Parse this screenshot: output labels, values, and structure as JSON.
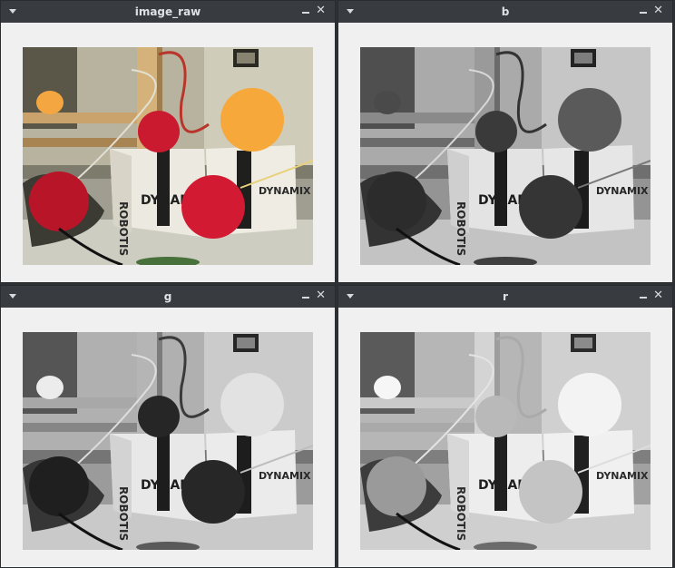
{
  "windows": [
    {
      "title": "image_raw",
      "mode": "color",
      "image_name": "camera-image-raw"
    },
    {
      "title": "b",
      "mode": "blue-channel",
      "image_name": "camera-image-blue"
    },
    {
      "title": "g",
      "mode": "green-channel",
      "image_name": "camera-image-green"
    },
    {
      "title": "r",
      "mode": "red-channel",
      "image_name": "camera-image-red"
    }
  ],
  "titlebar": {
    "close_glyph": "✕"
  },
  "colors": {
    "titlebar_bg": "#383c40",
    "window_bg": "#f0f0f0",
    "ball_red": "#c8192c",
    "ball_orange": "#f5a03c"
  }
}
